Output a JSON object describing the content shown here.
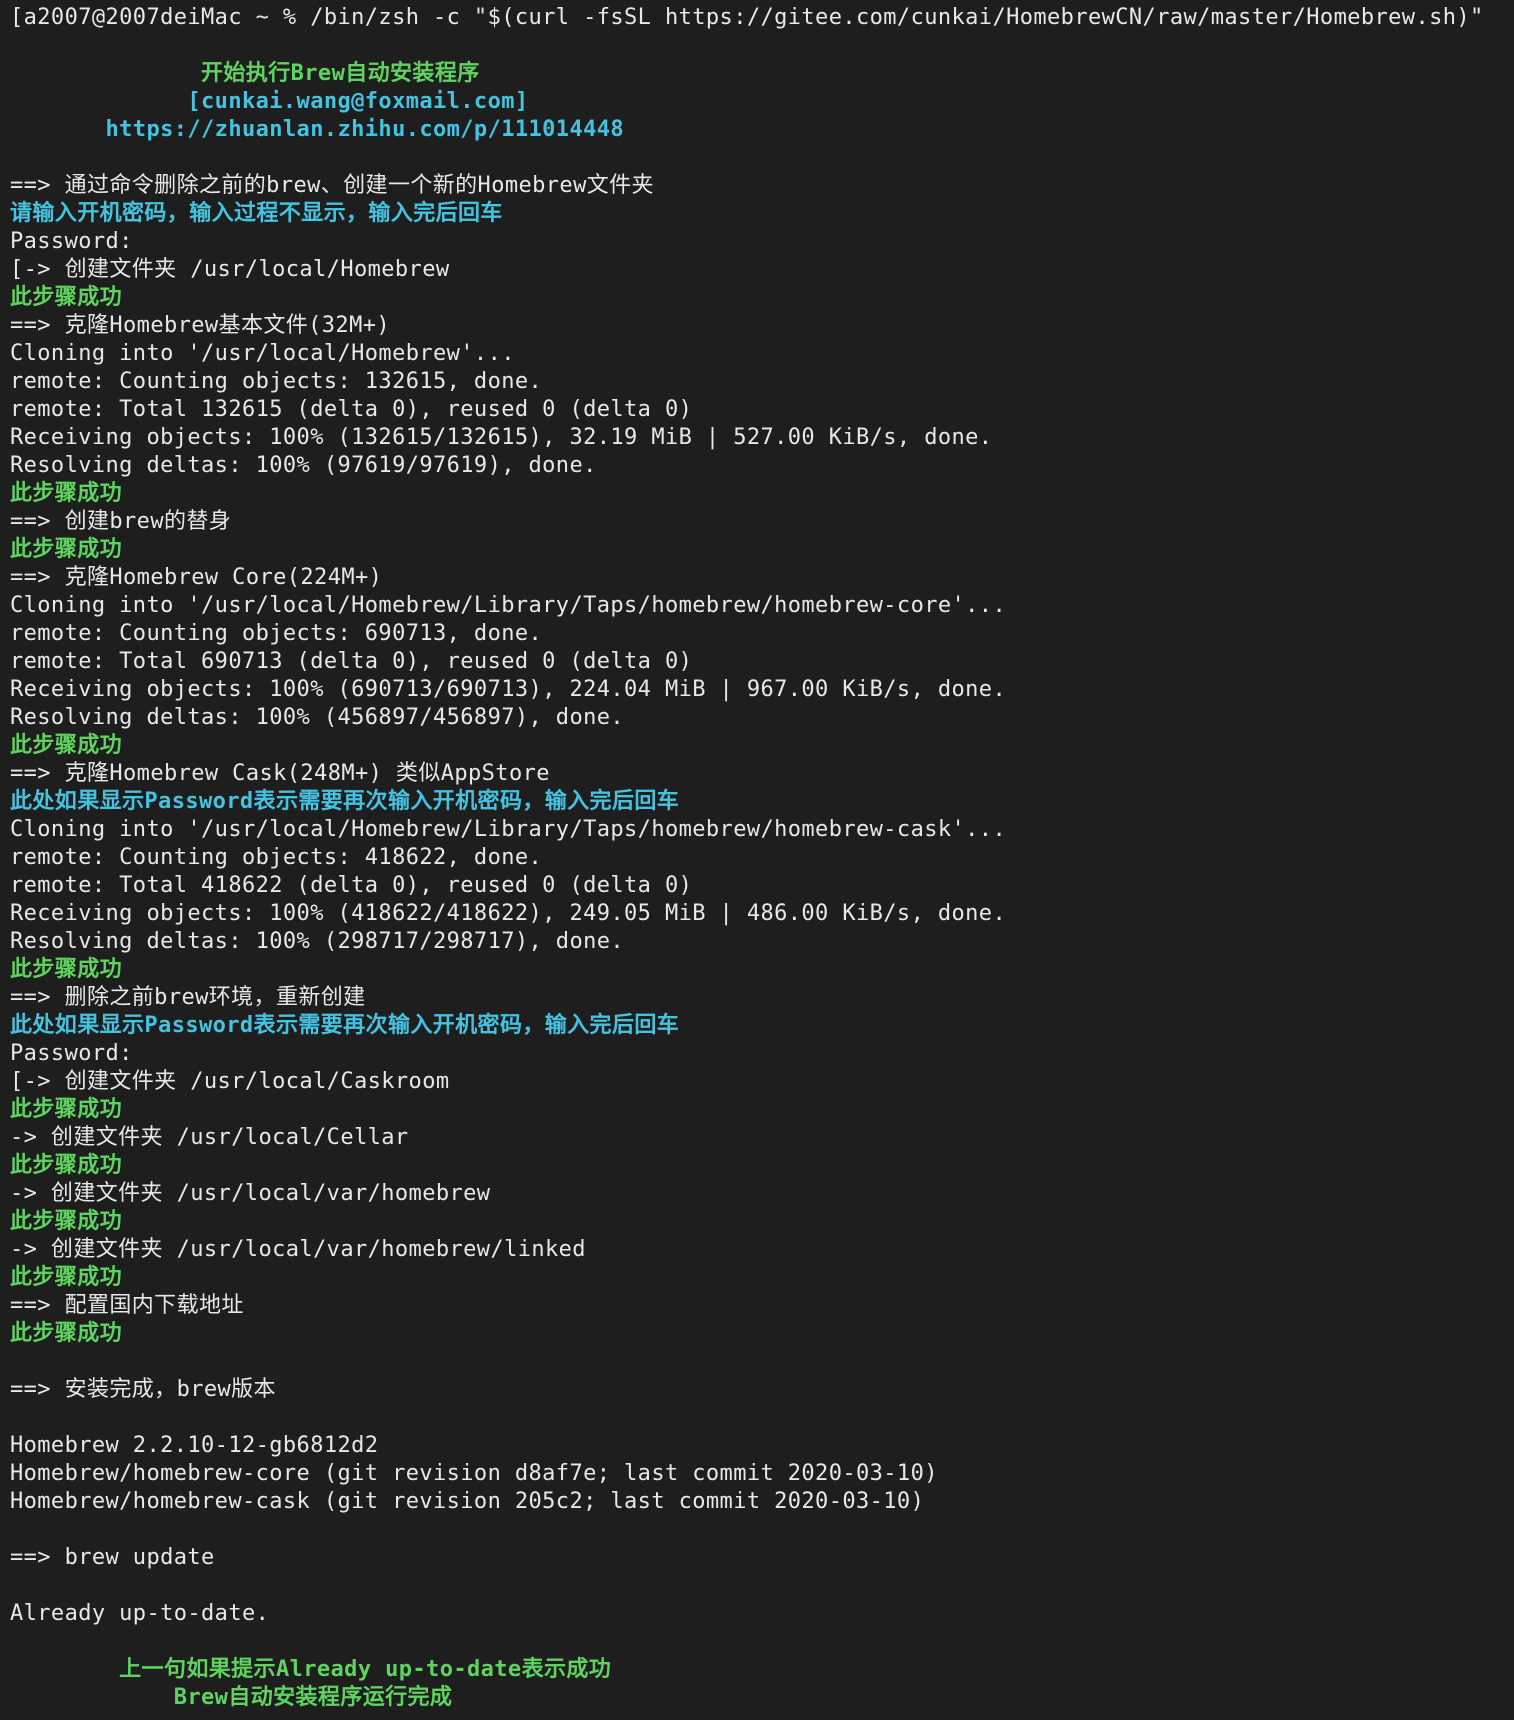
{
  "terminal": {
    "colors": {
      "background": "#1e1e1e",
      "text": "#e8e8e8",
      "success_green": "#5fd35f",
      "info_cyan": "#44c3e0"
    },
    "lines": [
      {
        "text": "[a2007@2007deiMac ~ % /bin/zsh -c \"$(curl -fsSL https://gitee.com/cunkai/HomebrewCN/raw/master/Homebrew.sh)\"",
        "style": "white"
      },
      {
        "text": "",
        "style": "white"
      },
      {
        "text": "              开始执行Brew自动安装程序",
        "style": "green"
      },
      {
        "text": "             [cunkai.wang@foxmail.com]",
        "style": "cyan"
      },
      {
        "text": "       https://zhuanlan.zhihu.com/p/111014448",
        "style": "cyan"
      },
      {
        "text": "",
        "style": "white"
      },
      {
        "text": "==> 通过命令删除之前的brew、创建一个新的Homebrew文件夹",
        "style": "white"
      },
      {
        "text": "请输入开机密码，输入过程不显示，输入完后回车",
        "style": "cyan"
      },
      {
        "text": "Password:",
        "style": "white"
      },
      {
        "text": "[-> 创建文件夹 /usr/local/Homebrew",
        "style": "white"
      },
      {
        "text": "此步骤成功",
        "style": "green"
      },
      {
        "text": "==> 克隆Homebrew基本文件(32M+)",
        "style": "white"
      },
      {
        "text": "Cloning into '/usr/local/Homebrew'...",
        "style": "white"
      },
      {
        "text": "remote: Counting objects: 132615, done.",
        "style": "white"
      },
      {
        "text": "remote: Total 132615 (delta 0), reused 0 (delta 0)",
        "style": "white"
      },
      {
        "text": "Receiving objects: 100% (132615/132615), 32.19 MiB | 527.00 KiB/s, done.",
        "style": "white"
      },
      {
        "text": "Resolving deltas: 100% (97619/97619), done.",
        "style": "white"
      },
      {
        "text": "此步骤成功",
        "style": "green"
      },
      {
        "text": "==> 创建brew的替身",
        "style": "white"
      },
      {
        "text": "此步骤成功",
        "style": "green"
      },
      {
        "text": "==> 克隆Homebrew Core(224M+)",
        "style": "white"
      },
      {
        "text": "Cloning into '/usr/local/Homebrew/Library/Taps/homebrew/homebrew-core'...",
        "style": "white"
      },
      {
        "text": "remote: Counting objects: 690713, done.",
        "style": "white"
      },
      {
        "text": "remote: Total 690713 (delta 0), reused 0 (delta 0)",
        "style": "white"
      },
      {
        "text": "Receiving objects: 100% (690713/690713), 224.04 MiB | 967.00 KiB/s, done.",
        "style": "white"
      },
      {
        "text": "Resolving deltas: 100% (456897/456897), done.",
        "style": "white"
      },
      {
        "text": "此步骤成功",
        "style": "green"
      },
      {
        "text": "==> 克隆Homebrew Cask(248M+) 类似AppStore",
        "style": "white"
      },
      {
        "text": "此处如果显示Password表示需要再次输入开机密码，输入完后回车",
        "style": "cyan"
      },
      {
        "text": "Cloning into '/usr/local/Homebrew/Library/Taps/homebrew/homebrew-cask'...",
        "style": "white"
      },
      {
        "text": "remote: Counting objects: 418622, done.",
        "style": "white"
      },
      {
        "text": "remote: Total 418622 (delta 0), reused 0 (delta 0)",
        "style": "white"
      },
      {
        "text": "Receiving objects: 100% (418622/418622), 249.05 MiB | 486.00 KiB/s, done.",
        "style": "white"
      },
      {
        "text": "Resolving deltas: 100% (298717/298717), done.",
        "style": "white"
      },
      {
        "text": "此步骤成功",
        "style": "green"
      },
      {
        "text": "==> 删除之前brew环境，重新创建",
        "style": "white"
      },
      {
        "text": "此处如果显示Password表示需要再次输入开机密码，输入完后回车",
        "style": "cyan"
      },
      {
        "text": "Password:",
        "style": "white"
      },
      {
        "text": "[-> 创建文件夹 /usr/local/Caskroom",
        "style": "white"
      },
      {
        "text": "此步骤成功",
        "style": "green"
      },
      {
        "text": "-> 创建文件夹 /usr/local/Cellar",
        "style": "white"
      },
      {
        "text": "此步骤成功",
        "style": "green"
      },
      {
        "text": "-> 创建文件夹 /usr/local/var/homebrew",
        "style": "white"
      },
      {
        "text": "此步骤成功",
        "style": "green"
      },
      {
        "text": "-> 创建文件夹 /usr/local/var/homebrew/linked",
        "style": "white"
      },
      {
        "text": "此步骤成功",
        "style": "green"
      },
      {
        "text": "==> 配置国内下载地址",
        "style": "white"
      },
      {
        "text": "此步骤成功",
        "style": "green"
      },
      {
        "text": "",
        "style": "white"
      },
      {
        "text": "==> 安装完成，brew版本",
        "style": "white"
      },
      {
        "text": "",
        "style": "white"
      },
      {
        "text": "Homebrew 2.2.10-12-gb6812d2",
        "style": "white"
      },
      {
        "text": "Homebrew/homebrew-core (git revision d8af7e; last commit 2020-03-10)",
        "style": "white"
      },
      {
        "text": "Homebrew/homebrew-cask (git revision 205c2; last commit 2020-03-10)",
        "style": "white"
      },
      {
        "text": "",
        "style": "white"
      },
      {
        "text": "==> brew update",
        "style": "white"
      },
      {
        "text": "",
        "style": "white"
      },
      {
        "text": "Already up-to-date.",
        "style": "white"
      },
      {
        "text": "",
        "style": "white"
      },
      {
        "text": "        上一句如果提示Already up-to-date表示成功",
        "style": "green"
      },
      {
        "text": "            Brew自动安装程序运行完成",
        "style": "green"
      }
    ]
  }
}
